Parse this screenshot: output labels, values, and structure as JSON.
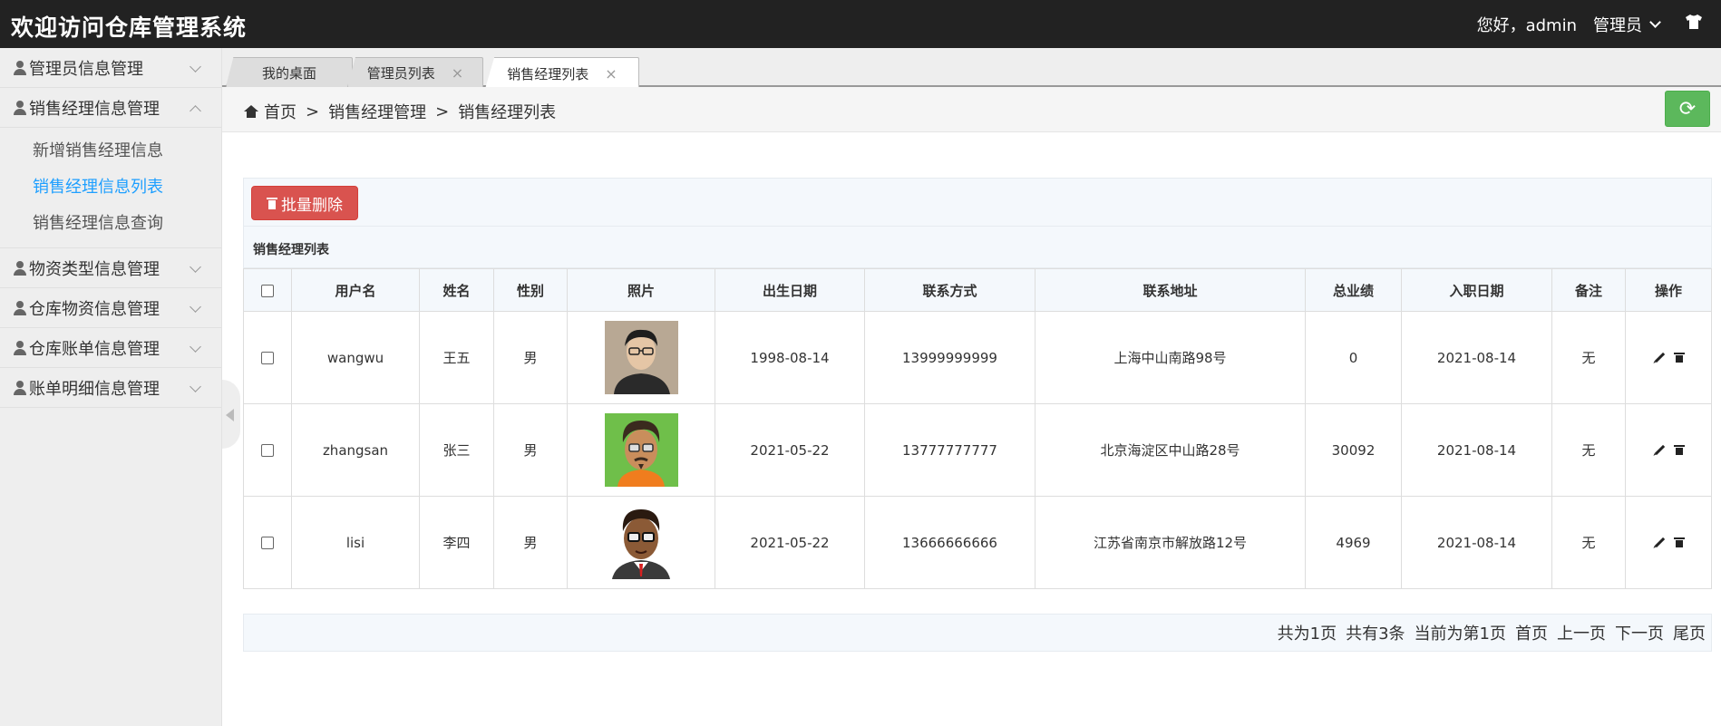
{
  "header": {
    "title": "欢迎访问仓库管理系统",
    "greeting": "您好，admin",
    "role": "管理员"
  },
  "sidebar": {
    "items": [
      {
        "label": "管理员信息管理",
        "expanded": false
      },
      {
        "label": "销售经理信息管理",
        "expanded": true,
        "children": [
          "新增销售经理信息",
          "销售经理信息列表",
          "销售经理信息查询"
        ],
        "active_child": "销售经理信息列表"
      },
      {
        "label": "物资类型信息管理",
        "expanded": false
      },
      {
        "label": "仓库物资信息管理",
        "expanded": false
      },
      {
        "label": "仓库账单信息管理",
        "expanded": false
      },
      {
        "label": "账单明细信息管理",
        "expanded": false
      }
    ]
  },
  "tabs": [
    {
      "label": "我的桌面",
      "closable": false
    },
    {
      "label": "管理员列表",
      "closable": true,
      "close": "×"
    },
    {
      "label": "销售经理列表",
      "closable": true,
      "active": true,
      "close": "×"
    }
  ],
  "breadcrumb": {
    "home": "首页",
    "sep": ">",
    "level1": "销售经理管理",
    "level2": "销售经理列表"
  },
  "refresh_icon": "⟳",
  "toolbar": {
    "batch_delete": "批量删除"
  },
  "panel_title": "销售经理列表",
  "table": {
    "headers": [
      "用户名",
      "姓名",
      "性别",
      "照片",
      "出生日期",
      "联系方式",
      "联系地址",
      "总业绩",
      "入职日期",
      "备注",
      "操作"
    ],
    "rows": [
      {
        "username": "wangwu",
        "name": "王五",
        "gender": "男",
        "photo": "young-man-glasses-photo",
        "birth": "1998-08-14",
        "phone": "13999999999",
        "address": "上海中山南路98号",
        "performance": "0",
        "hire_date": "2021-08-14",
        "remark": "无"
      },
      {
        "username": "zhangsan",
        "name": "张三",
        "gender": "男",
        "photo": "cartoon-avatar-green",
        "birth": "2021-05-22",
        "phone": "13777777777",
        "address": "北京海淀区中山路28号",
        "performance": "30092",
        "hire_date": "2021-08-14",
        "remark": "无"
      },
      {
        "username": "lisi",
        "name": "李四",
        "gender": "男",
        "photo": "cartoon-avatar-suit",
        "birth": "2021-05-22",
        "phone": "13666666666",
        "address": "江苏省南京市解放路12号",
        "performance": "4969",
        "hire_date": "2021-08-14",
        "remark": "无"
      }
    ]
  },
  "pager": {
    "total_pages": "共为1页",
    "total_records": "共有3条",
    "current": "当前为第1页",
    "first": "首页",
    "prev": "上一页",
    "next": "下一页",
    "last": "尾页"
  },
  "colors": {
    "header_bg": "#222222",
    "active_link": "#1E9FFF",
    "danger": "#d9534f",
    "success": "#5cb85c"
  }
}
